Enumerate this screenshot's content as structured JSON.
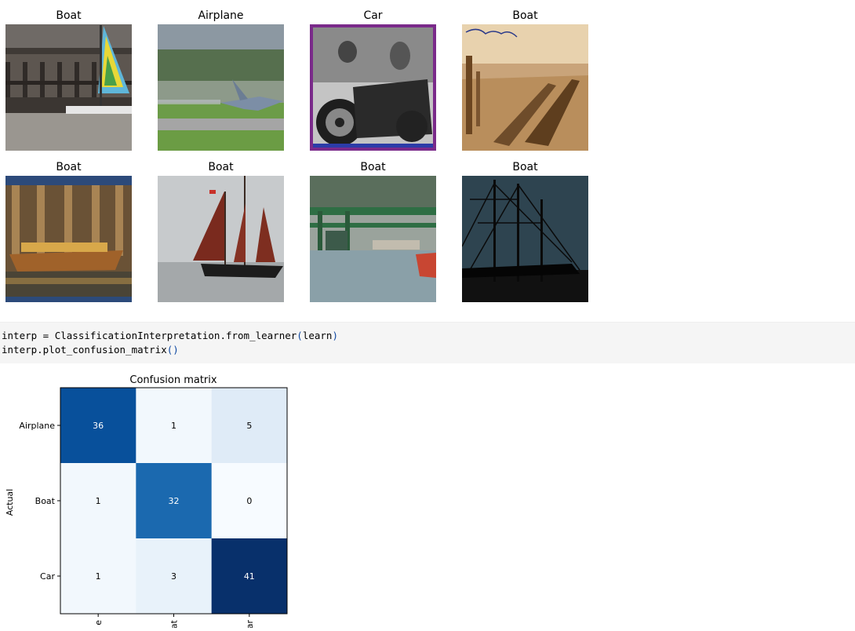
{
  "thumbnails": [
    {
      "label": "Boat"
    },
    {
      "label": "Airplane"
    },
    {
      "label": "Car"
    },
    {
      "label": "Boat"
    },
    {
      "label": "Boat"
    },
    {
      "label": "Boat"
    },
    {
      "label": "Boat"
    },
    {
      "label": "Boat"
    }
  ],
  "code": {
    "line1": {
      "var": "interp",
      "eq": " = ",
      "cls": "ClassificationInterpretation",
      "method": ".from_learner",
      "open": "(",
      "arg": "learn",
      "close": ")"
    },
    "line2": {
      "obj": "interp",
      "method": ".plot_confusion_matrix",
      "parens": "()"
    }
  },
  "colors": {
    "code_bracket": "#0d47a1",
    "heatmap_max": "#08306b",
    "heatmap_min": "#f7fbff"
  },
  "chart_data": {
    "type": "heatmap",
    "title": "Confusion matrix",
    "ylabel": "Actual",
    "rows": [
      "Airplane",
      "Boat",
      "Car"
    ],
    "cols_tick_visible": [
      "e",
      "at",
      "ar"
    ],
    "values": [
      [
        36,
        1,
        5
      ],
      [
        1,
        32,
        0
      ],
      [
        1,
        3,
        41
      ]
    ],
    "colormap": "Blues"
  }
}
